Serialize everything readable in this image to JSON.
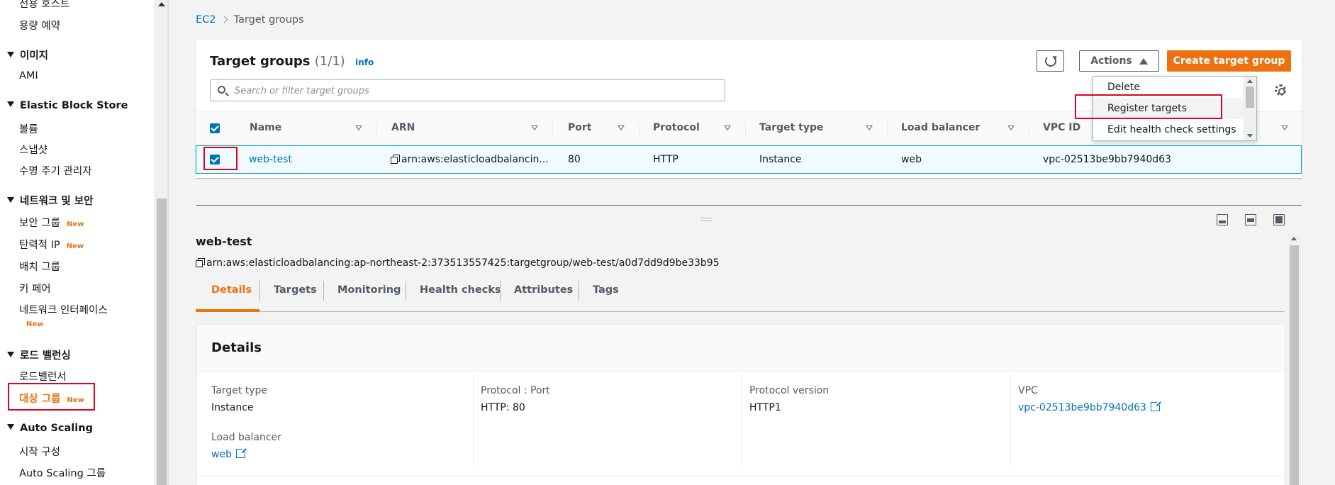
{
  "sidebar": {
    "items": [
      {
        "label": "전용 호스트",
        "kind": "item"
      },
      {
        "label": "용량 예약",
        "kind": "item"
      },
      {
        "label": "이미지",
        "kind": "header"
      },
      {
        "label": "AMI",
        "kind": "item"
      },
      {
        "label": "Elastic Block Store",
        "kind": "header"
      },
      {
        "label": "볼륨",
        "kind": "item"
      },
      {
        "label": "스냅샷",
        "kind": "item"
      },
      {
        "label": "수명 주기 관리자",
        "kind": "item"
      },
      {
        "label": "네트워크 및 보안",
        "kind": "header"
      },
      {
        "label": "보안 그룹",
        "kind": "item",
        "badge": "New"
      },
      {
        "label": "탄력적 IP",
        "kind": "item",
        "badge": "New"
      },
      {
        "label": "배치 그룹",
        "kind": "item"
      },
      {
        "label": "키 페어",
        "kind": "item"
      },
      {
        "label": "네트워크 인터페이스",
        "kind": "item",
        "badge": "New"
      },
      {
        "label": "로드 밸런싱",
        "kind": "header"
      },
      {
        "label": "로드밸런서",
        "kind": "item"
      },
      {
        "label": "대상 그룹",
        "kind": "item",
        "badge": "New",
        "active": true
      },
      {
        "label": "Auto Scaling",
        "kind": "header"
      },
      {
        "label": "시작 구성",
        "kind": "item"
      },
      {
        "label": "Auto Scaling 그룹",
        "kind": "item"
      }
    ]
  },
  "breadcrumb": {
    "root": "EC2",
    "current": "Target groups"
  },
  "panel": {
    "title": "Target groups",
    "count": "(1/1)",
    "info": "info",
    "actions_label": "Actions",
    "create_label": "Create target group",
    "search_placeholder": "Search or filter target groups"
  },
  "actions_menu": {
    "items": [
      "Delete",
      "Register targets",
      "Edit health check settings"
    ],
    "highlighted_index": 1
  },
  "table": {
    "columns": [
      "Name",
      "ARN",
      "Port",
      "Protocol",
      "Target type",
      "Load balancer",
      "VPC ID"
    ],
    "rows": [
      {
        "selected": true,
        "name": "web-test",
        "arn": "arn:aws:elasticloadbalancin...",
        "port": "80",
        "protocol": "HTTP",
        "target_type": "Instance",
        "load_balancer": "web",
        "vpc_id": "vpc-02513be9bb7940d63"
      }
    ]
  },
  "detail": {
    "title": "web-test",
    "arn": "arn:aws:elasticloadbalancing:ap-northeast-2:373513557425:targetgroup/web-test/a0d7dd9d9be33b95",
    "tabs": [
      "Details",
      "Targets",
      "Monitoring",
      "Health checks",
      "Attributes",
      "Tags"
    ],
    "active_tab": 0,
    "card_title": "Details",
    "fields": {
      "target_type_label": "Target type",
      "target_type_value": "Instance",
      "protocol_port_label": "Protocol : Port",
      "protocol_port_value": "HTTP: 80",
      "protocol_version_label": "Protocol version",
      "protocol_version_value": "HTTP1",
      "vpc_label": "VPC",
      "vpc_value": "vpc-02513be9bb7940d63",
      "load_balancer_label": "Load balancer",
      "load_balancer_value": "web"
    }
  },
  "colors": {
    "accent": "#ec7211",
    "link": "#0073bb",
    "highlight_box": "#e1001e",
    "selected_row": "#f1faff"
  }
}
